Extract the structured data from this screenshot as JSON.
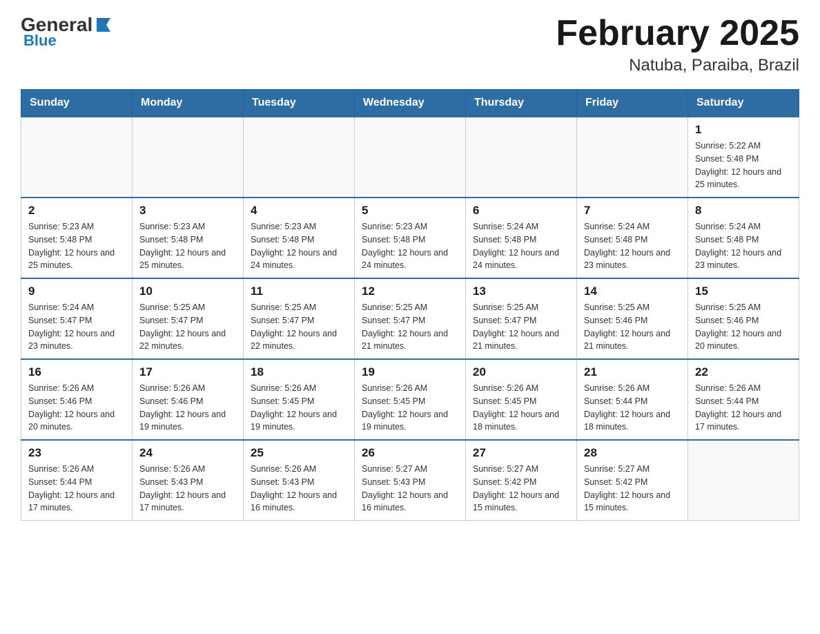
{
  "header": {
    "logo_general": "General",
    "logo_blue": "Blue",
    "title": "February 2025",
    "subtitle": "Natuba, Paraiba, Brazil"
  },
  "days_of_week": [
    "Sunday",
    "Monday",
    "Tuesday",
    "Wednesday",
    "Thursday",
    "Friday",
    "Saturday"
  ],
  "weeks": [
    [
      {
        "day": "",
        "info": ""
      },
      {
        "day": "",
        "info": ""
      },
      {
        "day": "",
        "info": ""
      },
      {
        "day": "",
        "info": ""
      },
      {
        "day": "",
        "info": ""
      },
      {
        "day": "",
        "info": ""
      },
      {
        "day": "1",
        "info": "Sunrise: 5:22 AM\nSunset: 5:48 PM\nDaylight: 12 hours and 25 minutes."
      }
    ],
    [
      {
        "day": "2",
        "info": "Sunrise: 5:23 AM\nSunset: 5:48 PM\nDaylight: 12 hours and 25 minutes."
      },
      {
        "day": "3",
        "info": "Sunrise: 5:23 AM\nSunset: 5:48 PM\nDaylight: 12 hours and 25 minutes."
      },
      {
        "day": "4",
        "info": "Sunrise: 5:23 AM\nSunset: 5:48 PM\nDaylight: 12 hours and 24 minutes."
      },
      {
        "day": "5",
        "info": "Sunrise: 5:23 AM\nSunset: 5:48 PM\nDaylight: 12 hours and 24 minutes."
      },
      {
        "day": "6",
        "info": "Sunrise: 5:24 AM\nSunset: 5:48 PM\nDaylight: 12 hours and 24 minutes."
      },
      {
        "day": "7",
        "info": "Sunrise: 5:24 AM\nSunset: 5:48 PM\nDaylight: 12 hours and 23 minutes."
      },
      {
        "day": "8",
        "info": "Sunrise: 5:24 AM\nSunset: 5:48 PM\nDaylight: 12 hours and 23 minutes."
      }
    ],
    [
      {
        "day": "9",
        "info": "Sunrise: 5:24 AM\nSunset: 5:47 PM\nDaylight: 12 hours and 23 minutes."
      },
      {
        "day": "10",
        "info": "Sunrise: 5:25 AM\nSunset: 5:47 PM\nDaylight: 12 hours and 22 minutes."
      },
      {
        "day": "11",
        "info": "Sunrise: 5:25 AM\nSunset: 5:47 PM\nDaylight: 12 hours and 22 minutes."
      },
      {
        "day": "12",
        "info": "Sunrise: 5:25 AM\nSunset: 5:47 PM\nDaylight: 12 hours and 21 minutes."
      },
      {
        "day": "13",
        "info": "Sunrise: 5:25 AM\nSunset: 5:47 PM\nDaylight: 12 hours and 21 minutes."
      },
      {
        "day": "14",
        "info": "Sunrise: 5:25 AM\nSunset: 5:46 PM\nDaylight: 12 hours and 21 minutes."
      },
      {
        "day": "15",
        "info": "Sunrise: 5:25 AM\nSunset: 5:46 PM\nDaylight: 12 hours and 20 minutes."
      }
    ],
    [
      {
        "day": "16",
        "info": "Sunrise: 5:26 AM\nSunset: 5:46 PM\nDaylight: 12 hours and 20 minutes."
      },
      {
        "day": "17",
        "info": "Sunrise: 5:26 AM\nSunset: 5:46 PM\nDaylight: 12 hours and 19 minutes."
      },
      {
        "day": "18",
        "info": "Sunrise: 5:26 AM\nSunset: 5:45 PM\nDaylight: 12 hours and 19 minutes."
      },
      {
        "day": "19",
        "info": "Sunrise: 5:26 AM\nSunset: 5:45 PM\nDaylight: 12 hours and 19 minutes."
      },
      {
        "day": "20",
        "info": "Sunrise: 5:26 AM\nSunset: 5:45 PM\nDaylight: 12 hours and 18 minutes."
      },
      {
        "day": "21",
        "info": "Sunrise: 5:26 AM\nSunset: 5:44 PM\nDaylight: 12 hours and 18 minutes."
      },
      {
        "day": "22",
        "info": "Sunrise: 5:26 AM\nSunset: 5:44 PM\nDaylight: 12 hours and 17 minutes."
      }
    ],
    [
      {
        "day": "23",
        "info": "Sunrise: 5:26 AM\nSunset: 5:44 PM\nDaylight: 12 hours and 17 minutes."
      },
      {
        "day": "24",
        "info": "Sunrise: 5:26 AM\nSunset: 5:43 PM\nDaylight: 12 hours and 17 minutes."
      },
      {
        "day": "25",
        "info": "Sunrise: 5:26 AM\nSunset: 5:43 PM\nDaylight: 12 hours and 16 minutes."
      },
      {
        "day": "26",
        "info": "Sunrise: 5:27 AM\nSunset: 5:43 PM\nDaylight: 12 hours and 16 minutes."
      },
      {
        "day": "27",
        "info": "Sunrise: 5:27 AM\nSunset: 5:42 PM\nDaylight: 12 hours and 15 minutes."
      },
      {
        "day": "28",
        "info": "Sunrise: 5:27 AM\nSunset: 5:42 PM\nDaylight: 12 hours and 15 minutes."
      },
      {
        "day": "",
        "info": ""
      }
    ]
  ]
}
